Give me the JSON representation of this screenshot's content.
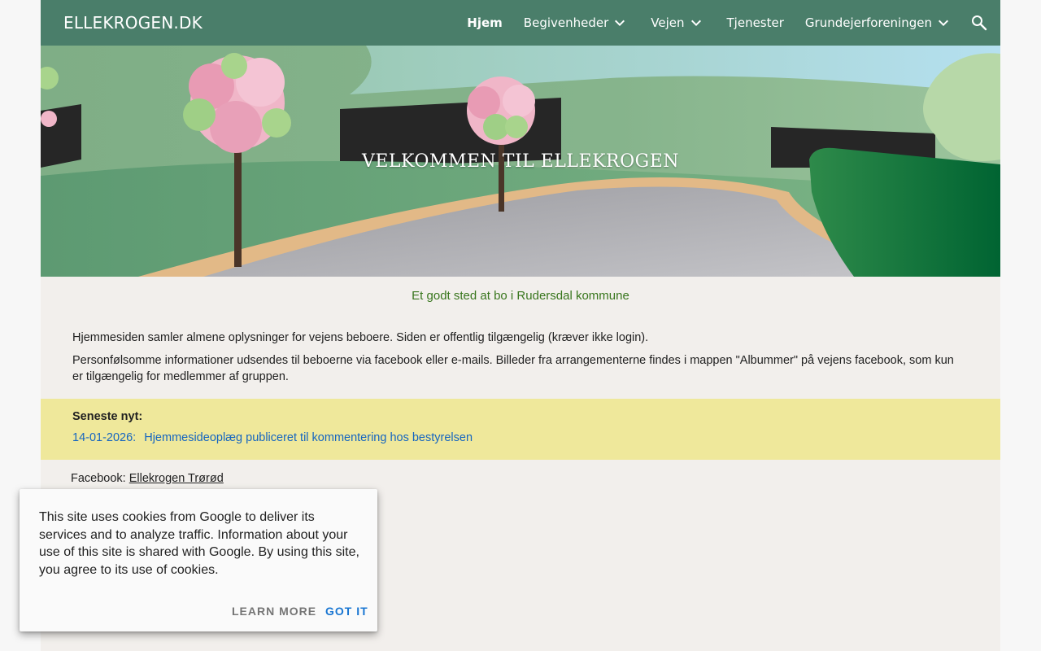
{
  "header": {
    "site_title": "ELLEKROGEN.DK",
    "nav": [
      {
        "label": "Hjem",
        "active": true,
        "has_dropdown": false
      },
      {
        "label": "Begivenheder",
        "active": false,
        "has_dropdown": true
      },
      {
        "label": "Vejen",
        "active": false,
        "has_dropdown": true
      },
      {
        "label": "Tjenester",
        "active": false,
        "has_dropdown": false
      },
      {
        "label": "Grundejerforeningen",
        "active": false,
        "has_dropdown": true
      }
    ],
    "search_icon": "search-icon",
    "bar_color": "#4a7e6a"
  },
  "hero": {
    "title": "VELKOMMEN TIL ELLEKROGEN"
  },
  "main": {
    "tagline": "Et godt sted at bo i Rudersdal kommune",
    "paragraphs": [
      "Hjemmesiden samler almene oplysninger for vejens beboere. Siden er offentlig tilgængelig (kræver ikke login).",
      "Personfølsomme informationer udsendes til beboerne via facebook eller e-mails. Billeder fra arrangementerne findes i mappen \"Albummer\" på vejens facebook, som kun er tilgængelig for medlemmer af gruppen."
    ],
    "news": {
      "heading": "Seneste nyt:",
      "date": "14-01-2026:",
      "link_text": "Hjemmesideoplæg publiceret til kommentering hos bestyrelsen"
    },
    "facebook": {
      "label": "Facebook:",
      "link_text": "Ellekrogen Trørød"
    }
  },
  "cookie_banner": {
    "text": "This site uses cookies from Google to deliver its services and to analyze traffic. Information about your use of this site is shared with Google. By using this site, you agree to its use of cookies.",
    "learn_more": "LEARN MORE",
    "got_it": "GOT IT"
  },
  "colors": {
    "accent_green": "#38761d",
    "link_blue": "#1565c0",
    "news_bg": "#efe89b"
  }
}
